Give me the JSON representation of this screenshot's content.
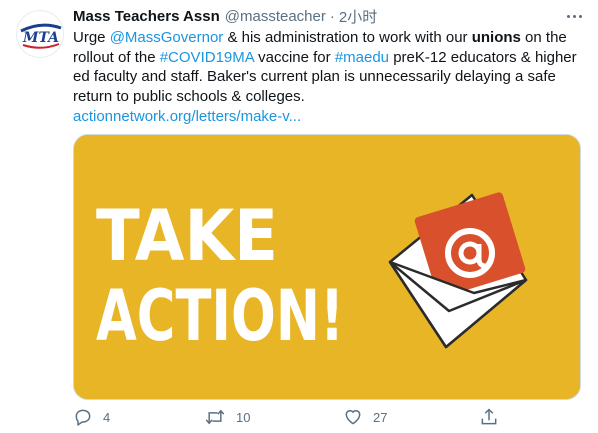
{
  "tweet": {
    "author_name": "Mass Teachers Assn",
    "author_handle": "@massteacher",
    "separator": "·",
    "time": "2小时",
    "avatar_logo_text": "MTA",
    "text": {
      "p1": "Urge ",
      "mention": "@MassGovernor",
      "p2": " & his administration to work with our ",
      "bold_word": "unions",
      "p3": " on the rollout of the ",
      "hashtag1": "#COVID19MA",
      "p4": " vaccine for ",
      "hashtag2": "#maedu",
      "p5": " preK-12 educators & higher ed faculty and staff. Baker's current plan is unnecessarily delaying a safe return to public schools & colleges.",
      "url": "actionnetwork.org/letters/make-v..."
    },
    "media": {
      "line1": "TAKE",
      "line2": "ACTION!",
      "icon": "email-at-icon",
      "background_color": "#e8b526",
      "card_color": "#d9502c"
    },
    "actions": {
      "reply_count": "4",
      "retweet_count": "10",
      "like_count": "27"
    }
  }
}
